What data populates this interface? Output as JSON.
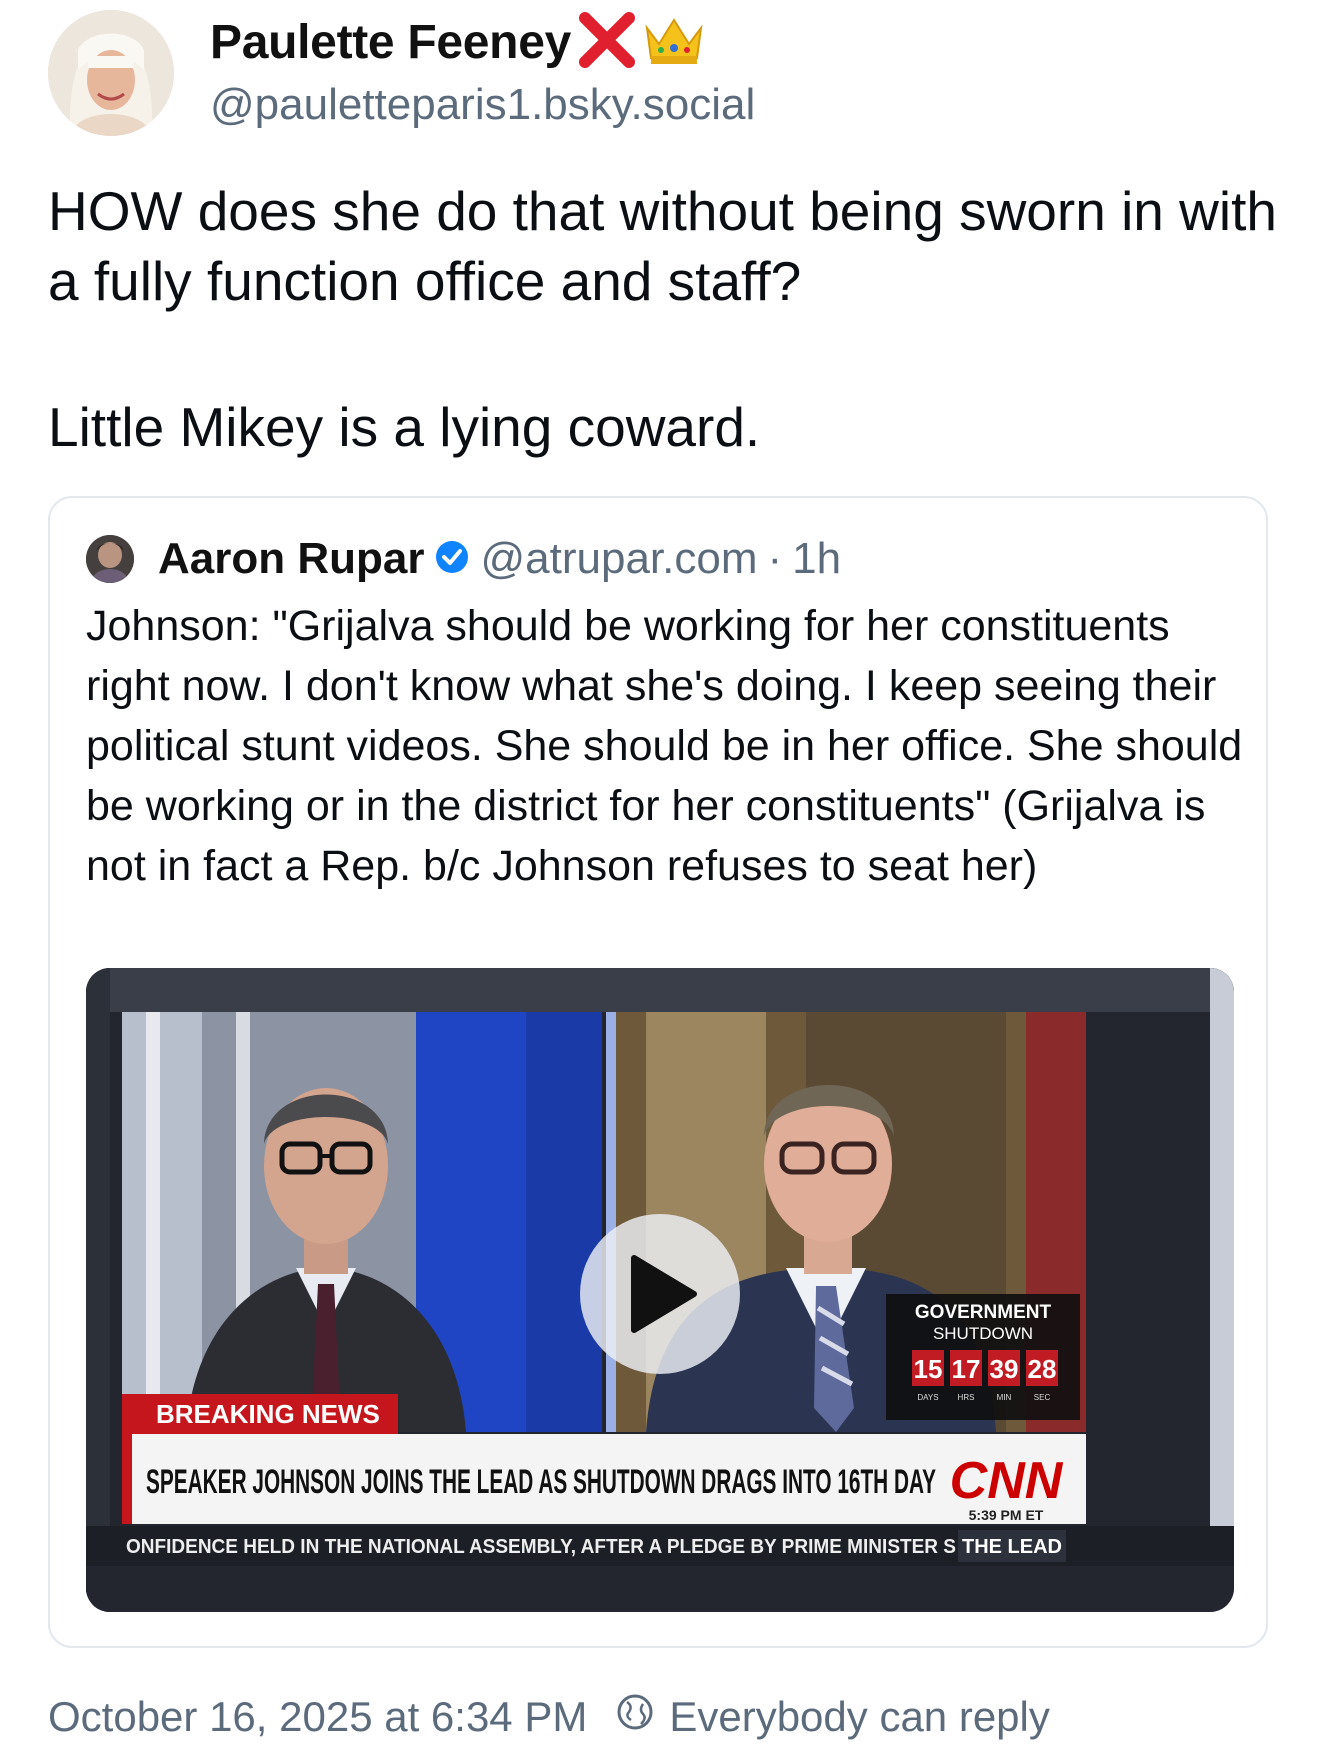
{
  "author": {
    "display_name": "Paulette Feeney",
    "name_emojis": [
      "red-x",
      "crown"
    ],
    "handle": "@pauletteparis1.bsky.social"
  },
  "post": {
    "paragraphs": [
      "HOW does she do that without being sworn in with a fully function office and staff?",
      "Little Mikey is a lying coward."
    ]
  },
  "quote": {
    "name": "Aaron Rupar",
    "verified": true,
    "handle": "@atrupar.com",
    "separator": "·",
    "time": "1h",
    "text": "Johnson: \"Grijalva should be working for her constituents right now. I don't know what she's doing. I keep seeing their political stunt videos. She should be in her office. She should be working or in the district for her constituents\" (Grijalva is not in fact a Rep. b/c Johnson refuses to seat her)",
    "video": {
      "breaking_label": "BREAKING NEWS",
      "headline": "SPEAKER JOHNSON JOINS THE LEAD AS SHUTDOWN DRAGS INTO 16TH DAY",
      "network": "CNN",
      "clock": "5:39 PM ET",
      "ticker": "ONFIDENCE HELD IN THE NATIONAL ASSEMBLY, AFTER A PLEDGE BY PRIME MINISTER S",
      "show": "THE LEAD",
      "shutdown_title_1": "GOVERNMENT",
      "shutdown_title_2": "SHUTDOWN",
      "counter": {
        "days": "15",
        "hrs": "17",
        "min": "39",
        "sec": "28",
        "days_label": "DAYS",
        "hrs_label": "HRS",
        "min_label": "MIN",
        "sec_label": "SEC"
      }
    }
  },
  "footer": {
    "timestamp": "October 16, 2025 at 6:34 PM",
    "reply_setting": "Everybody can reply"
  },
  "colors": {
    "text": "#0b0f14",
    "muted": "#5b6b7b",
    "verified": "#1083fe",
    "cnn_red": "#cc0000",
    "card_border": "#e3e8ee"
  }
}
